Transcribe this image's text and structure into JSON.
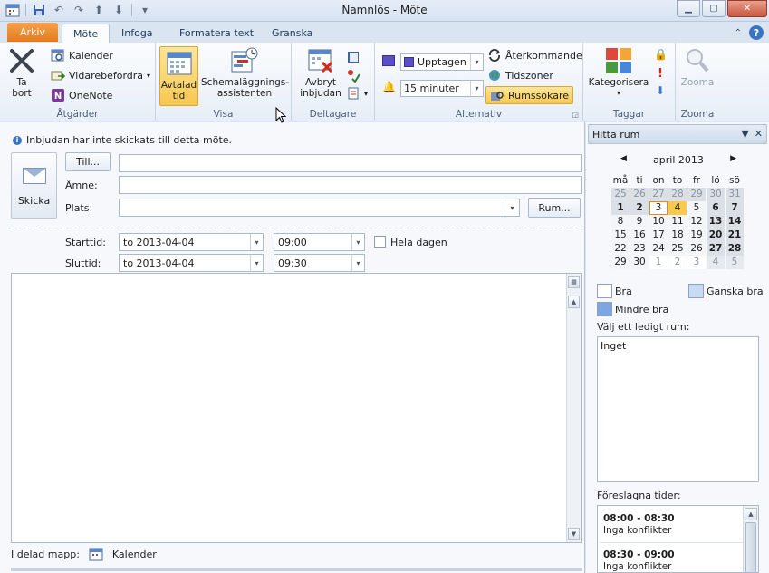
{
  "window": {
    "title": "Namnlös  -  Möte",
    "quick_access": [
      "calendar-app-icon",
      "save-icon",
      "undo-icon",
      "redo-icon",
      "up-icon",
      "down-icon",
      "customize-icon"
    ]
  },
  "tabs": {
    "file": "Arkiv",
    "items": [
      "Möte",
      "Infoga",
      "Formatera text",
      "Granska"
    ],
    "active": "Möte"
  },
  "ribbon": {
    "atgarder": {
      "label": "Åtgärder",
      "delete": "Ta\nbort",
      "delete_line1": "Ta",
      "delete_line2": "bort",
      "calendar": "Kalender",
      "forward": "Vidarebefordra",
      "onenote": "OneNote"
    },
    "visa": {
      "label": "Visa",
      "appointment_line1": "Avtalad",
      "appointment_line2": "tid",
      "scheduling_line1": "Schemaläggnings-",
      "scheduling_line2": "assistenten"
    },
    "deltagare": {
      "label": "Deltagare",
      "cancel_line1": "Avbryt",
      "cancel_line2": "inbjudan"
    },
    "alternativ": {
      "label": "Alternativ",
      "show_as": "Upptagen",
      "reminder": "15 minuter",
      "recurrence": "Återkommande",
      "timezones": "Tidszoner",
      "room_finder": "Rumssökare"
    },
    "taggar": {
      "label": "Taggar",
      "categorize": "Kategorisera"
    },
    "zoom": {
      "label": "Zooma",
      "button": "Zooma"
    }
  },
  "form": {
    "info": "Inbjudan har inte skickats till detta möte.",
    "send": "Skicka",
    "to_button": "Till...",
    "subject_label": "Ämne:",
    "location_label": "Plats:",
    "rooms_button": "Rum...",
    "start_label": "Starttid:",
    "end_label": "Sluttid:",
    "start_date": "to 2013-04-04",
    "start_time": "09:00",
    "end_date": "to 2013-04-04",
    "end_time": "09:30",
    "all_day": "Hela dagen",
    "shared_folder_label": "I delad mapp:",
    "shared_folder": "Kalender"
  },
  "pane": {
    "title": "Hitta rum",
    "month": "april 2013",
    "weekdays": [
      "må",
      "ti",
      "on",
      "to",
      "fr",
      "lö",
      "sö"
    ],
    "weeks": [
      [
        "25",
        "26",
        "27",
        "28",
        "29",
        "30",
        "31"
      ],
      [
        "1",
        "2",
        "3",
        "4",
        "5",
        "6",
        "7"
      ],
      [
        "8",
        "9",
        "10",
        "11",
        "12",
        "13",
        "14"
      ],
      [
        "15",
        "16",
        "17",
        "18",
        "19",
        "20",
        "21"
      ],
      [
        "22",
        "23",
        "24",
        "25",
        "26",
        "27",
        "28"
      ],
      [
        "29",
        "30",
        "1",
        "2",
        "3",
        "4",
        "5"
      ]
    ],
    "legend_good": "Bra",
    "legend_fair": "Ganska bra",
    "legend_poor": "Mindre bra",
    "choose_room": "Välj ett ledigt rum:",
    "room_value": "Inget",
    "suggested_label": "Föreslagna tider:",
    "suggestions": [
      {
        "time": "08:00 - 08:30",
        "status": "Inga konflikter"
      },
      {
        "time": "08:30 - 09:00",
        "status": "Inga konflikter"
      }
    ]
  },
  "colors": {
    "accent_orange": "#e27a1d",
    "selected_yellow": "#f8c84f",
    "busy_purple": "#5b4fc7",
    "legend_fair": "#c6dcf5",
    "legend_poor": "#7ea6df"
  }
}
